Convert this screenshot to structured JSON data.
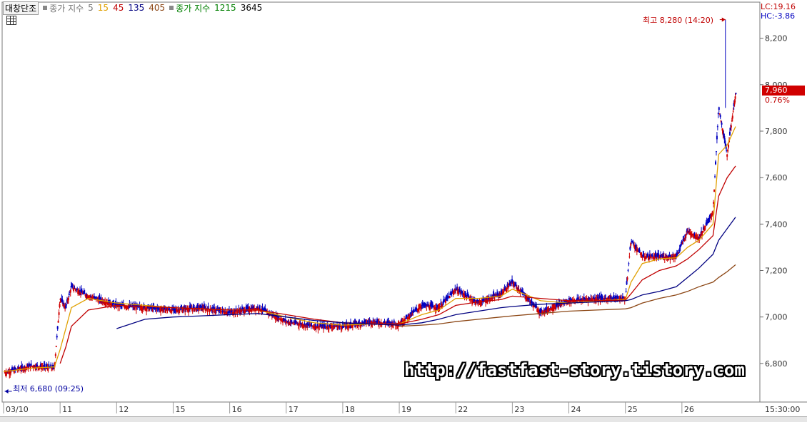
{
  "header": {
    "chart_name": "대창단조",
    "ma_close_label": "종가 지수",
    "ma_periods_1": [
      "5",
      "15",
      "45",
      "135",
      "405"
    ],
    "ma_periods_1_colors": [
      "#222222",
      "#e0a000",
      "#c00000",
      "#000080",
      "#8b4513"
    ],
    "ma_close_label_2": "종가 지수",
    "ma_periods_2": [
      "1215",
      "3645"
    ]
  },
  "right_panel": {
    "lc_label": "LC:19.16",
    "hc_label": "HC:-3.86",
    "current_price": "7,960",
    "change_pct": "0.76%",
    "time_label": "15:30:00"
  },
  "annotations": {
    "high": "최고 8,280 (14:20)",
    "low": "최저 6,680 (09:25)"
  },
  "watermark": "http://fastfast-story.tistory.com",
  "chart_data": {
    "type": "line",
    "title": "",
    "xlabel": "",
    "ylabel": "",
    "ylim": [
      6640,
      8340
    ],
    "yticks": [
      6800,
      7000,
      7200,
      7400,
      7600,
      7800,
      8000,
      8200
    ],
    "ytick_labels": [
      "6,800",
      "7,000",
      "7,200",
      "7,400",
      "7,600",
      "7,800",
      "8,000",
      "8,200"
    ],
    "categories": [
      "03/10",
      "11",
      "12",
      "15",
      "16",
      "17",
      "18",
      "19",
      "22",
      "23",
      "24",
      "25",
      "26"
    ],
    "x_range": [
      0,
      13
    ],
    "x": [
      0.0,
      0.5,
      0.9,
      1.0,
      1.1,
      1.2,
      1.5,
      2.0,
      2.5,
      3.0,
      3.5,
      4.0,
      4.5,
      5.0,
      5.5,
      6.0,
      6.5,
      7.0,
      7.4,
      7.7,
      8.0,
      8.4,
      8.8,
      9.0,
      9.5,
      10.0,
      10.5,
      11.0,
      11.1,
      11.3,
      11.6,
      11.9,
      12.1,
      12.3,
      12.55,
      12.65,
      12.8,
      12.95
    ],
    "series": [
      {
        "color": "#222222",
        "values": [
          6760,
          6790,
          6780,
          7080,
          7040,
          7130,
          7090,
          7050,
          7040,
          7030,
          7040,
          7020,
          7040,
          6980,
          6960,
          6960,
          6980,
          6970,
          7050,
          7040,
          7120,
          7060,
          7100,
          7150,
          7020,
          7070,
          7080,
          7080,
          7330,
          7260,
          7260,
          7260,
          7370,
          7340,
          7450,
          7900,
          7700,
          7960
        ]
      },
      {
        "color": "#e0a000",
        "values": [
          6765,
          6780,
          6785,
          6860,
          6950,
          7040,
          7080,
          7060,
          7050,
          7040,
          7035,
          7030,
          7030,
          7000,
          6975,
          6965,
          6970,
          6970,
          7010,
          7030,
          7080,
          7080,
          7090,
          7120,
          7070,
          7060,
          7070,
          7075,
          7150,
          7230,
          7250,
          7255,
          7300,
          7330,
          7400,
          7700,
          7740,
          7820
        ]
      },
      {
        "color": "#c00000",
        "values": [
          null,
          null,
          null,
          6800,
          6870,
          6960,
          7030,
          7050,
          7045,
          7040,
          7035,
          7030,
          7030,
          7010,
          6990,
          6975,
          6970,
          6970,
          6990,
          7010,
          7050,
          7065,
          7075,
          7090,
          7080,
          7070,
          7070,
          7072,
          7100,
          7160,
          7200,
          7220,
          7250,
          7290,
          7350,
          7520,
          7600,
          7650
        ]
      },
      {
        "color": "#000080",
        "values": [
          null,
          null,
          null,
          null,
          null,
          null,
          null,
          6950,
          6990,
          7000,
          7005,
          7010,
          7015,
          7000,
          6985,
          6975,
          6970,
          6965,
          6975,
          6990,
          7010,
          7025,
          7040,
          7045,
          7055,
          7060,
          7065,
          7070,
          7075,
          7095,
          7110,
          7130,
          7170,
          7210,
          7270,
          7330,
          7380,
          7430
        ]
      },
      {
        "color": "#8b4513",
        "values": [
          null,
          null,
          null,
          null,
          null,
          null,
          null,
          null,
          null,
          null,
          null,
          null,
          null,
          null,
          null,
          null,
          null,
          6960,
          6965,
          6970,
          6980,
          6990,
          7000,
          7005,
          7015,
          7025,
          7030,
          7035,
          7040,
          7060,
          7080,
          7095,
          7110,
          7130,
          7150,
          7170,
          7195,
          7225
        ]
      }
    ],
    "peak": {
      "x": 12.77,
      "value": 8280
    },
    "trough": {
      "x": 0.02,
      "value": 6680
    },
    "grid": false,
    "legend": "top-left"
  }
}
